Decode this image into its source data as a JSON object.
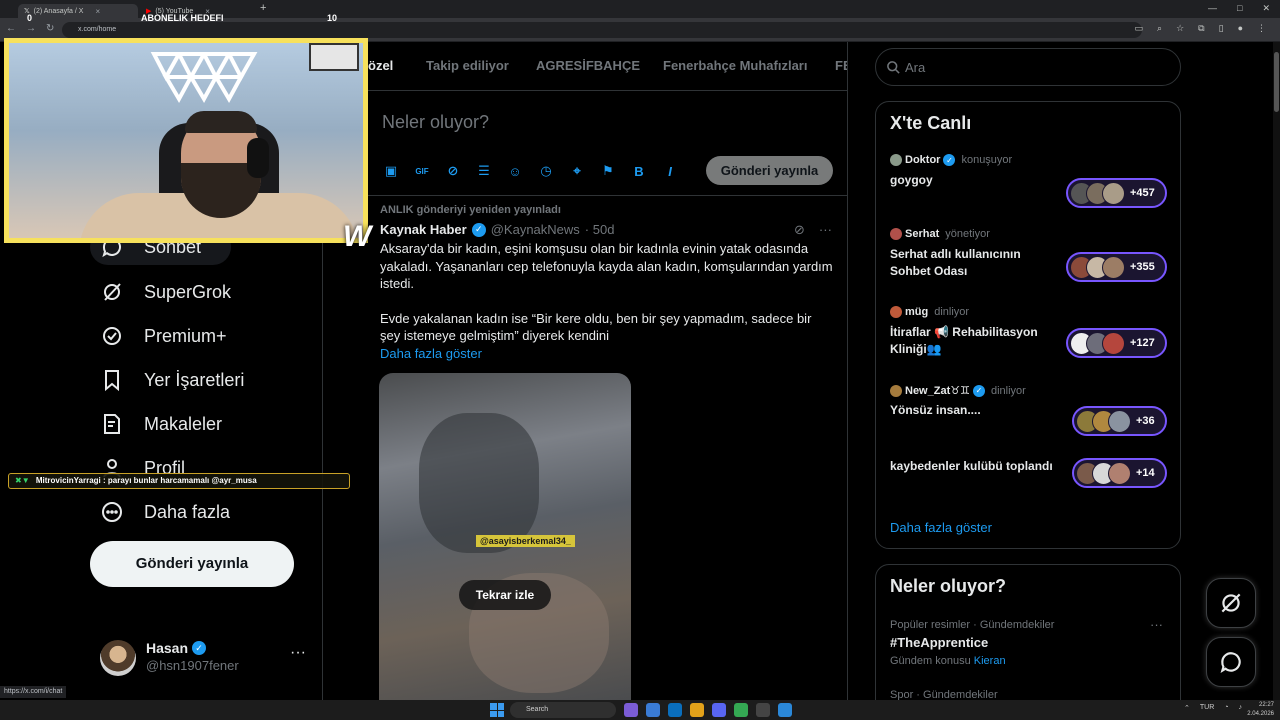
{
  "browser": {
    "tabs": [
      {
        "title": "(2) Anasayfa / X",
        "close": "×"
      },
      {
        "title": "(5) YouTube",
        "close": "×"
      }
    ],
    "new_tab": "+",
    "url": "x.com/home",
    "status_url": "https://x.com/i/chat"
  },
  "overlay": {
    "count_left": "0",
    "goal_label": "ABONELIK HEDEFI",
    "goal_value": "10",
    "logo": "W",
    "chat_message": "MitrovicinYarragi : parayı bunlar harcamamalı @ayr_musa"
  },
  "sidebar": {
    "items": [
      {
        "label": "Sohbet",
        "icon": "chat-icon"
      },
      {
        "label": "SuperGrok",
        "icon": "grok-icon"
      },
      {
        "label": "Premium+",
        "icon": "premium-icon"
      },
      {
        "label": "Yer İşaretleri",
        "icon": "bookmark-icon"
      },
      {
        "label": "Makaleler",
        "icon": "articles-icon"
      },
      {
        "label": "Profil",
        "icon": "profile-icon"
      },
      {
        "label": "Daha fazla",
        "icon": "more-circle-icon"
      }
    ],
    "post_button": "Gönderi yayınla",
    "profile": {
      "name": "Hasan",
      "handle": "@hsn1907fener",
      "more": "···"
    }
  },
  "main": {
    "tabs": [
      "özel",
      "Takip ediliyor",
      "AGRESİFBAHÇE",
      "Fenerbahçe Muhafızları",
      "FE"
    ],
    "compose_placeholder": "Neler oluyor?",
    "compose_icons": [
      "image-icon",
      "gif-icon",
      "grok-icon",
      "poll-icon",
      "emoji-icon",
      "schedule-icon",
      "location-icon",
      "flag-icon",
      "bold-icon",
      "italic-icon"
    ],
    "post_button": "Gönderi yayınla",
    "tweet": {
      "repost_line": "ANLIK gönderiyi yeniden yayınladı",
      "name": "Kaynak Haber",
      "handle": "@KaynakNews",
      "time": "· 50d",
      "paragraph1": "Aksaray'da bir kadın, eşini komşusu olan bir kadınla evinin yatak odasında yakaladı. Yaşananları cep telefonuyla kayda alan kadın, komşularından yardım istedi.",
      "paragraph2": "Evde yakalanan kadın ise “Bir kere oldu, ben bir şey yapmadım, sadece bir şey istemeye gelmiştim” diyerek kendini",
      "show_more": "Daha fazla göster",
      "video_watermark": "@asayisberkemal34_",
      "replay": "Tekrar izle"
    }
  },
  "right": {
    "search_placeholder": "Ara",
    "live": {
      "title": "X'te Canlı",
      "spaces": [
        {
          "host": "Doktor",
          "status": "konuşuyor",
          "title": "goygoy",
          "count": "+457"
        },
        {
          "host": "Serhat",
          "status": "yönetiyor",
          "title": "Serhat adlı kullanıcının Sohbet Odası",
          "count": "+355"
        },
        {
          "host": "müg",
          "status": "dinliyor",
          "title": "İtiraflar 📢 Rehabilitasyon Kliniği👥",
          "count": "+127"
        },
        {
          "host": "New_Zat♉♊",
          "status": "dinliyor",
          "title": "Yönsüz insan....",
          "count": "+36"
        },
        {
          "host": "",
          "status": "",
          "title": "kaybedenler kulübü toplandı",
          "count": "+14"
        }
      ],
      "show_more": "Daha fazla göster"
    },
    "trends": {
      "title": "Neler oluyor?",
      "meta": "Popüler resimler · Gündemdekiler",
      "name": "#TheApprentice",
      "sub_prefix": "Gündem konusu",
      "sub_link": "Kieran",
      "more": "···",
      "next_meta": "Spor · Gündemdekiler"
    }
  },
  "taskbar": {
    "search": "Search",
    "lang": "TUR",
    "time": "22:27",
    "date": "2.04.2026"
  },
  "colors": {
    "accent": "#1d9bf0",
    "live_purple": "#7856ff",
    "webcam_border": "#f7e15c"
  }
}
